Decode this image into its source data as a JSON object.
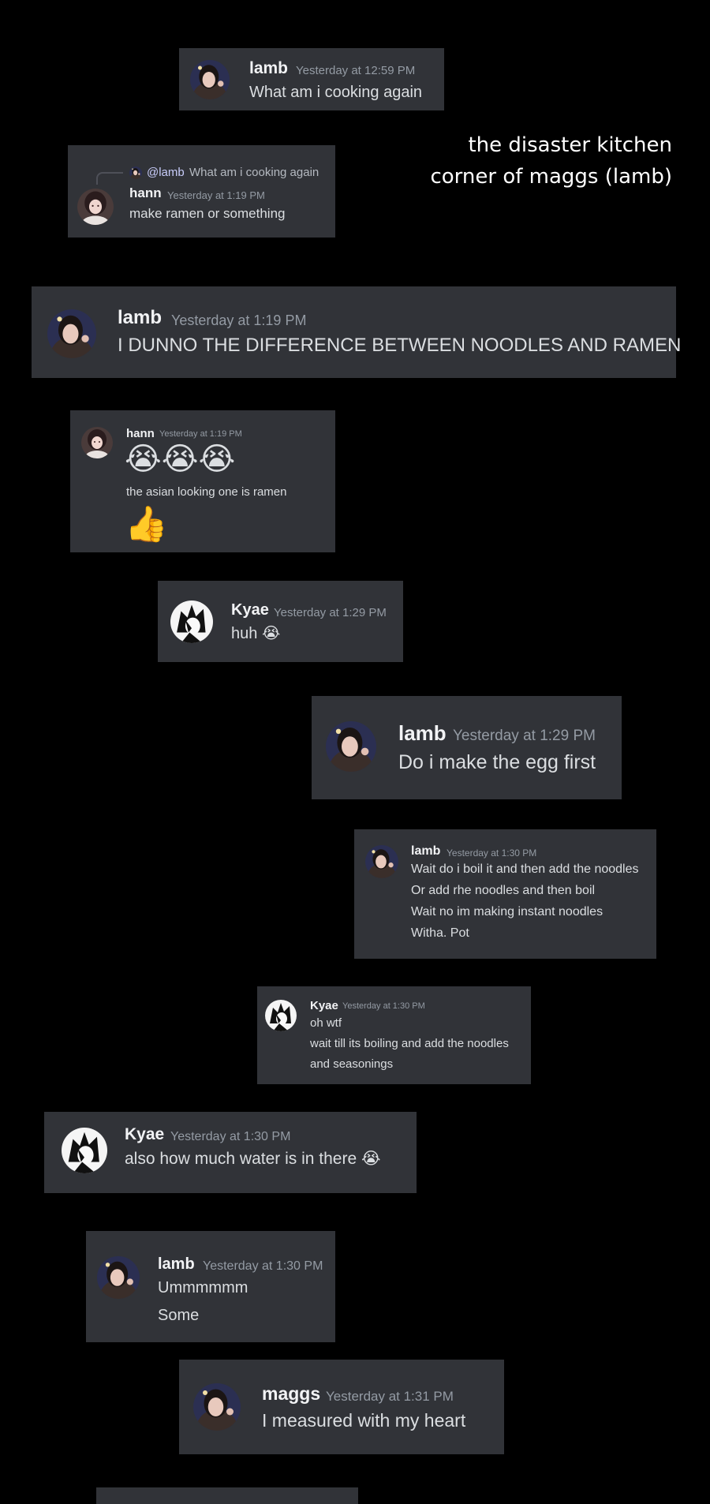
{
  "caption": {
    "line1": "the disaster kitchen",
    "line2": "corner of maggs (lamb)"
  },
  "messages": [
    {
      "id": "m1",
      "author": "lamb",
      "time": "Yesterday at 12:59 PM",
      "lines": [
        "What am i cooking again"
      ]
    },
    {
      "id": "m2",
      "author": "hann",
      "time": "Yesterday at 1:19 PM",
      "reply_mention": "@lamb",
      "reply_text": "What am i cooking again",
      "lines": [
        "make ramen or something"
      ]
    },
    {
      "id": "m3",
      "author": "lamb",
      "time": "Yesterday at 1:19 PM",
      "lines": [
        "I DUNNO THE DIFFERENCE BETWEEN NOODLES AND RAMEN"
      ]
    },
    {
      "id": "m4",
      "author": "hann",
      "time": "Yesterday at 1:19 PM",
      "emoji_row": "😭😭😭",
      "lines": [
        "the asian looking one is ramen"
      ],
      "emoji_after": "👍"
    },
    {
      "id": "m5",
      "author": "Kyae",
      "time": "Yesterday at 1:29 PM",
      "lines": [
        "huh"
      ],
      "inline_emoji": "😭"
    },
    {
      "id": "m6",
      "author": "lamb",
      "time": "Yesterday at 1:29 PM",
      "lines": [
        "Do i make the egg first"
      ]
    },
    {
      "id": "m7",
      "author": "lamb",
      "time": "Yesterday at 1:30 PM",
      "lines": [
        "Wait do i boil it and then add the noodles",
        "Or add rhe noodles and then boil",
        "Wait no im making instant noodles",
        "Witha. Pot"
      ]
    },
    {
      "id": "m8",
      "author": "Kyae",
      "time": "Yesterday at 1:30 PM",
      "lines": [
        "oh wtf",
        "wait till its boiling and add the noodles",
        "and seasonings"
      ]
    },
    {
      "id": "m9",
      "author": "Kyae",
      "time": "Yesterday at 1:30 PM",
      "lines": [
        "also how much water is in there"
      ],
      "inline_emoji": "😭"
    },
    {
      "id": "m10",
      "author": "lamb",
      "time": "Yesterday at 1:30 PM",
      "lines": [
        "Ummmmmm",
        "Some"
      ]
    },
    {
      "id": "m11",
      "author": "maggs",
      "time": "Yesterday at 1:31 PM",
      "lines": [
        "I measured with my heart"
      ]
    }
  ]
}
